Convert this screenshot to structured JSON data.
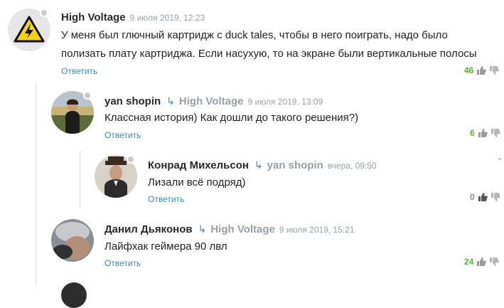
{
  "comments": [
    {
      "author": "High Voltage",
      "reply_to": "",
      "date": "9 июля 2019, 12:23",
      "text_lines": [
        "У меня был глючный картридж с duck tales, чтобы в него поиграть, надо было",
        "полизать плату картриджа. Если насухую, то на экране были вертикальные полосы"
      ],
      "reply_label": "Ответить",
      "score": "46"
    },
    {
      "author": "yan shopin",
      "reply_arrow": "↳",
      "reply_to": "High Voltage",
      "date": "9 июля 2019, 13:09",
      "text_lines": [
        "Классная история) Как дошли до такого решения?)"
      ],
      "reply_label": "Ответить",
      "score": "6"
    },
    {
      "author": "Конрад Михельсон",
      "reply_arrow": "↳",
      "reply_to": "yan shopin",
      "date": "вчера, 09:50",
      "text_lines": [
        "Лизали всё подряд)"
      ],
      "reply_label": "Ответить",
      "score": "0"
    },
    {
      "author": "Данил Дьяконов",
      "reply_arrow": "↳",
      "reply_to": "High Voltage",
      "date": "9 июля 2019, 15:21",
      "text_lines": [
        "Лайфхак геймера 90 лвл"
      ],
      "reply_label": "Ответить",
      "score": "24"
    }
  ],
  "colors": {
    "link": "#3d88b8",
    "positive_score": "#5aae3a",
    "muted": "#9aa0a6"
  },
  "icons": [
    "warning-high-voltage-icon",
    "thumb-up-icon",
    "thumb-down-icon",
    "reply-arrow-icon",
    "chevron-down-icon"
  ]
}
